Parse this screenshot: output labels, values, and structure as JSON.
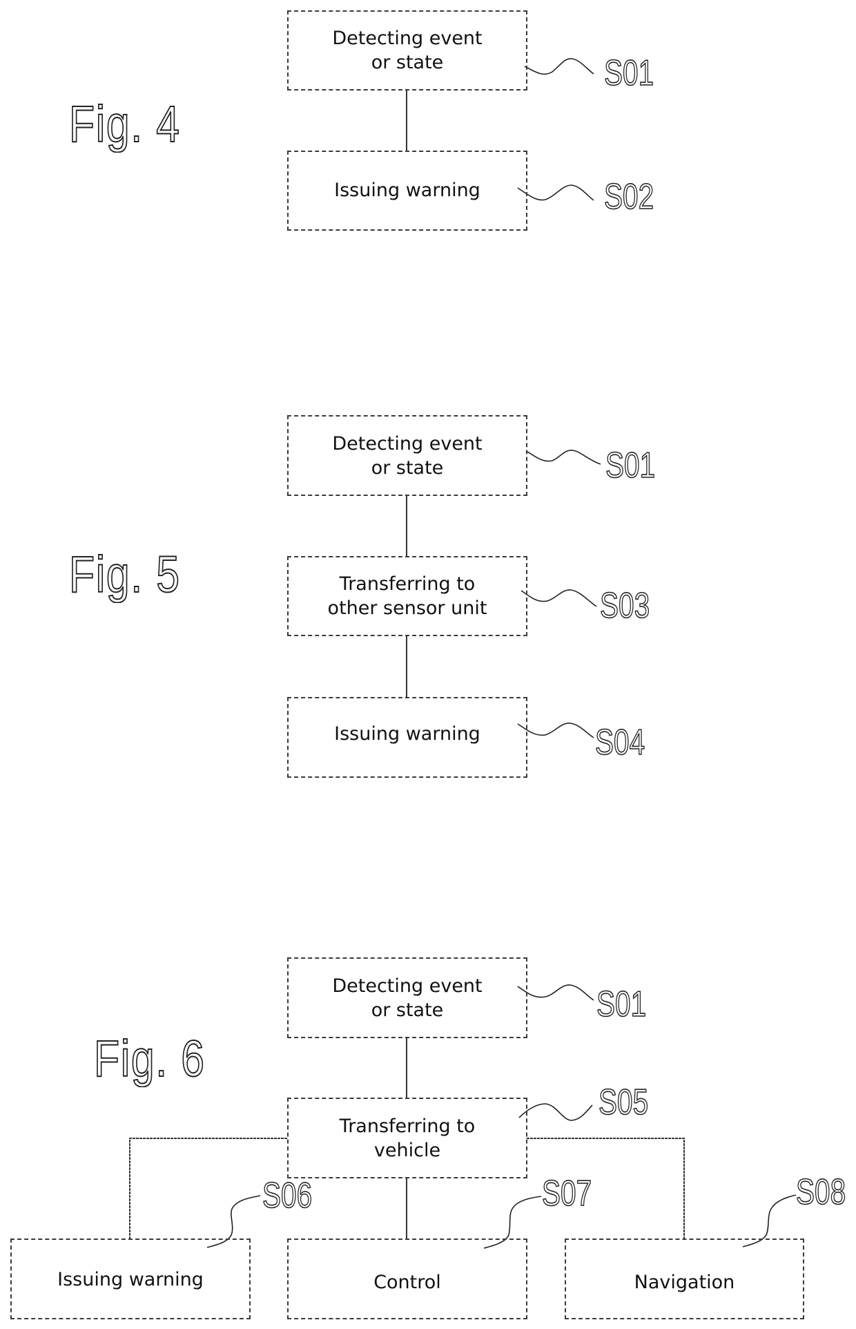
{
  "figures": {
    "fig4": {
      "label": "Fig. 4",
      "steps": [
        {
          "id": "S01",
          "lines": [
            "Detecting event",
            "or state"
          ]
        },
        {
          "id": "S02",
          "lines": [
            "Issuing warning"
          ]
        }
      ],
      "connections": [
        [
          "S01",
          "S02"
        ]
      ]
    },
    "fig5": {
      "label": "Fig. 5",
      "steps": [
        {
          "id": "S01",
          "lines": [
            "Detecting event",
            "or state"
          ]
        },
        {
          "id": "S03",
          "lines": [
            "Transferring to",
            "other sensor unit"
          ]
        },
        {
          "id": "S04",
          "lines": [
            "Issuing warning"
          ]
        }
      ],
      "connections": [
        [
          "S01",
          "S03"
        ],
        [
          "S03",
          "S04"
        ]
      ]
    },
    "fig6": {
      "label": "Fig. 6",
      "steps": [
        {
          "id": "S01",
          "lines": [
            "Detecting event",
            "or state"
          ]
        },
        {
          "id": "S05",
          "lines": [
            "Transferring to",
            "vehicle"
          ]
        },
        {
          "id": "S06",
          "lines": [
            "Issuing warning"
          ]
        },
        {
          "id": "S07",
          "lines": [
            "Control"
          ]
        },
        {
          "id": "S08",
          "lines": [
            "Navigation"
          ]
        }
      ],
      "connections": [
        [
          "S01",
          "S05"
        ],
        [
          "S05",
          "S06"
        ],
        [
          "S05",
          "S07"
        ],
        [
          "S05",
          "S08"
        ]
      ]
    }
  }
}
